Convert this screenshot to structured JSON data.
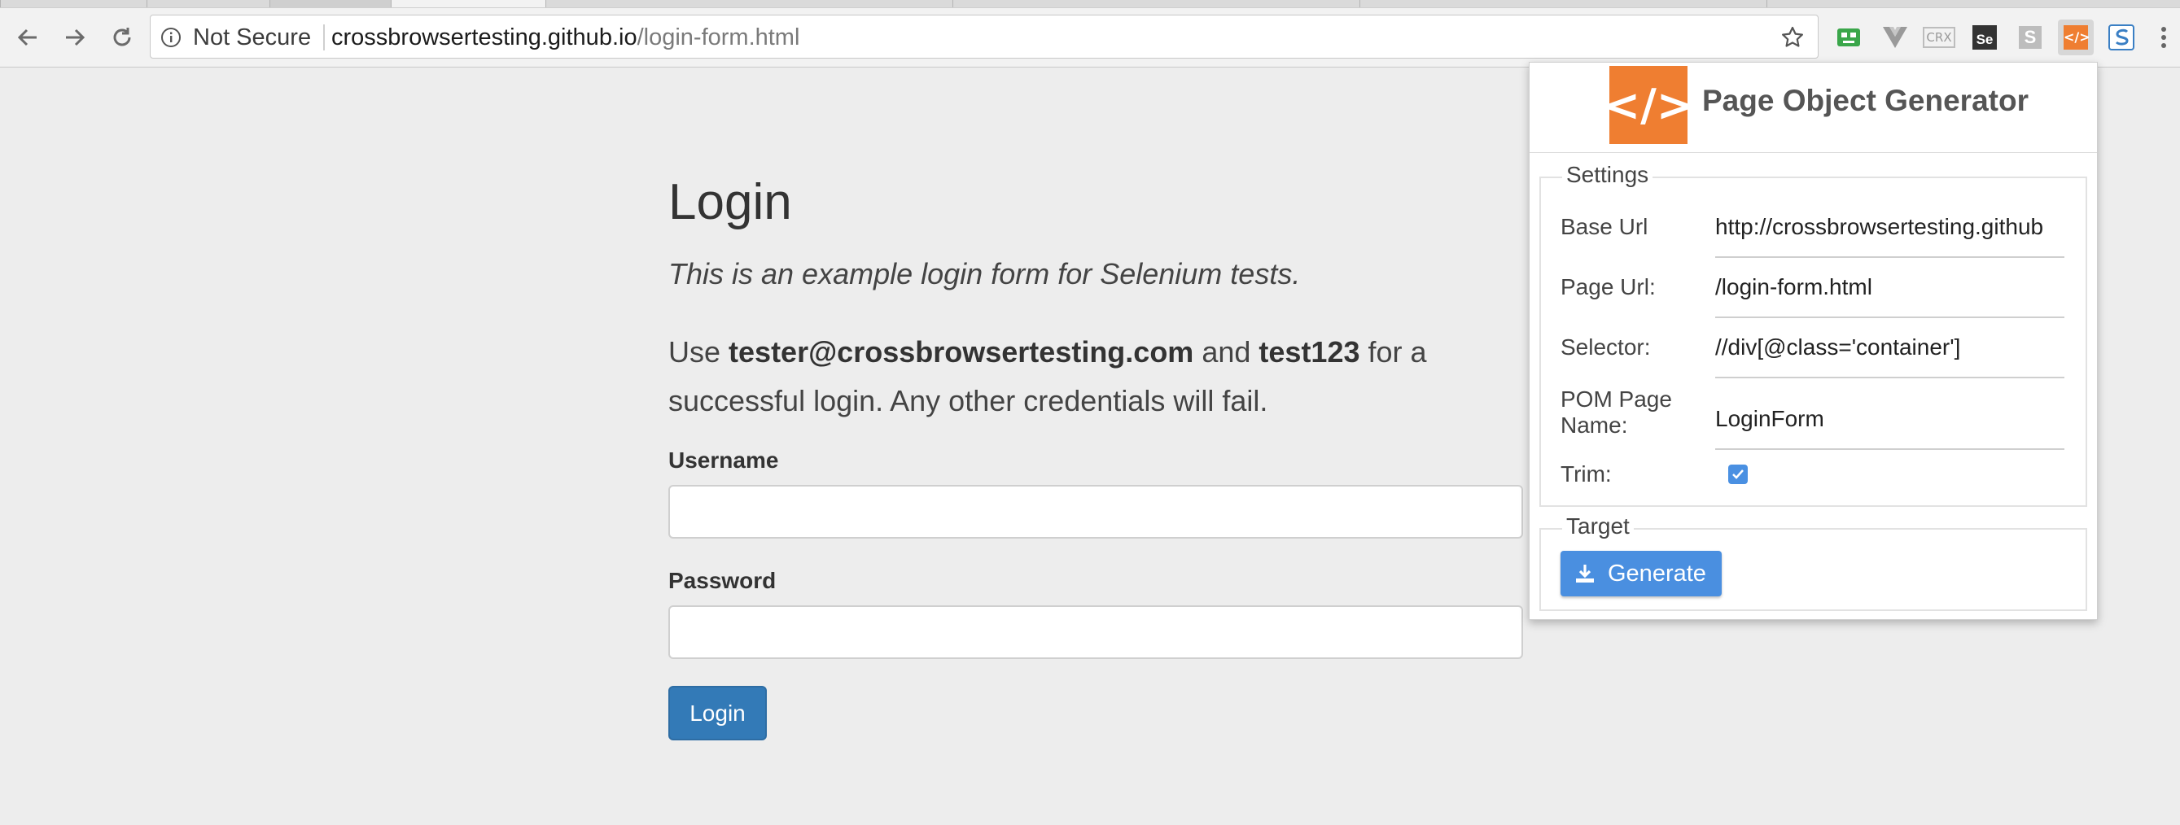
{
  "browser": {
    "address_bar": {
      "security_label": "Not Secure",
      "url_host": "crossbrowsertesting.github.io",
      "url_path": "/login-form.html"
    },
    "extensions": [
      "robot-icon",
      "vue-icon",
      "crx-icon",
      "selenium-icon",
      "s-icon",
      "code-icon",
      "s-blue-icon"
    ],
    "extension_labels": {
      "crx": "CRX",
      "selenium": "Se",
      "s": "S"
    }
  },
  "page": {
    "title": "Login",
    "lead": "This is an example login form for Selenium tests.",
    "intro": {
      "prefix": "Use ",
      "email": "tester@crossbrowsertesting.com",
      "middle": " and ",
      "password": "test123",
      "suffix": " for a successful login. Any other credentials will fail."
    },
    "username_label": "Username",
    "username_value": "",
    "password_label": "Password",
    "password_value": "",
    "login_button": "Login"
  },
  "popup": {
    "logo_text": "</>",
    "title": "Page Object Generator",
    "settings_legend": "Settings",
    "settings": {
      "base_url_label": "Base Url",
      "base_url_value": "http://crossbrowsertesting.github",
      "page_url_label": "Page Url:",
      "page_url_value": "/login-form.html",
      "selector_label": "Selector:",
      "selector_value": "//div[@class='container']",
      "pom_name_label": "POM Page Name:",
      "pom_name_value": "LoginForm",
      "trim_label": "Trim:",
      "trim_checked": true
    },
    "target_legend": "Target",
    "generate_button": "Generate"
  },
  "colors": {
    "accent": "#337ab7",
    "popup_logo": "#ef7e31",
    "generate": "#4a8fe0"
  }
}
